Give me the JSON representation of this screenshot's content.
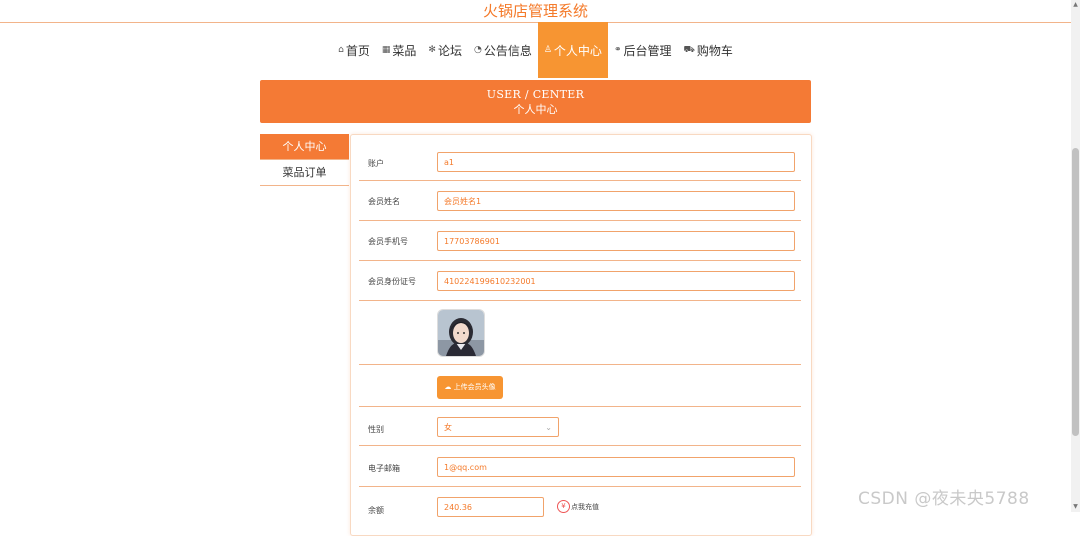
{
  "site": {
    "title": "火锅店管理系统"
  },
  "nav": {
    "items": [
      {
        "icon": "home-icon",
        "glyph": "⌂",
        "label": "首页"
      },
      {
        "icon": "grid-icon",
        "glyph": "▦",
        "label": "菜品"
      },
      {
        "icon": "asterisk-icon",
        "glyph": "✻",
        "label": "论坛"
      },
      {
        "icon": "gauge-icon",
        "glyph": "◔",
        "label": "公告信息"
      },
      {
        "icon": "user-icon",
        "glyph": "♙",
        "label": "个人中心"
      },
      {
        "icon": "link-icon",
        "glyph": "⚭",
        "label": "后台管理"
      },
      {
        "icon": "cart-icon",
        "glyph": "⛟",
        "label": "购物车"
      }
    ],
    "active_index": 4
  },
  "banner": {
    "en": "USER / CENTER",
    "cn": "个人中心"
  },
  "sidebar": {
    "items": [
      {
        "label": "个人中心",
        "active": true
      },
      {
        "label": "菜品订单",
        "active": false
      }
    ]
  },
  "form": {
    "account_label": "账户",
    "account_value": "a1",
    "name_label": "会员姓名",
    "name_value": "会员姓名1",
    "phone_label": "会员手机号",
    "phone_value": "17703786901",
    "idcard_label": "会员身份证号",
    "idcard_value": "410224199610232001",
    "upload_button": "上传会员头像",
    "gender_label": "性别",
    "gender_value": "女",
    "email_label": "电子邮箱",
    "email_value": "1@qq.com",
    "balance_label": "余额",
    "balance_value": "240.36",
    "recharge_label": "点我充值"
  },
  "watermark": "CSDN @夜未央5788",
  "colors": {
    "accent": "#f47a35",
    "nav_active": "#f79532"
  }
}
